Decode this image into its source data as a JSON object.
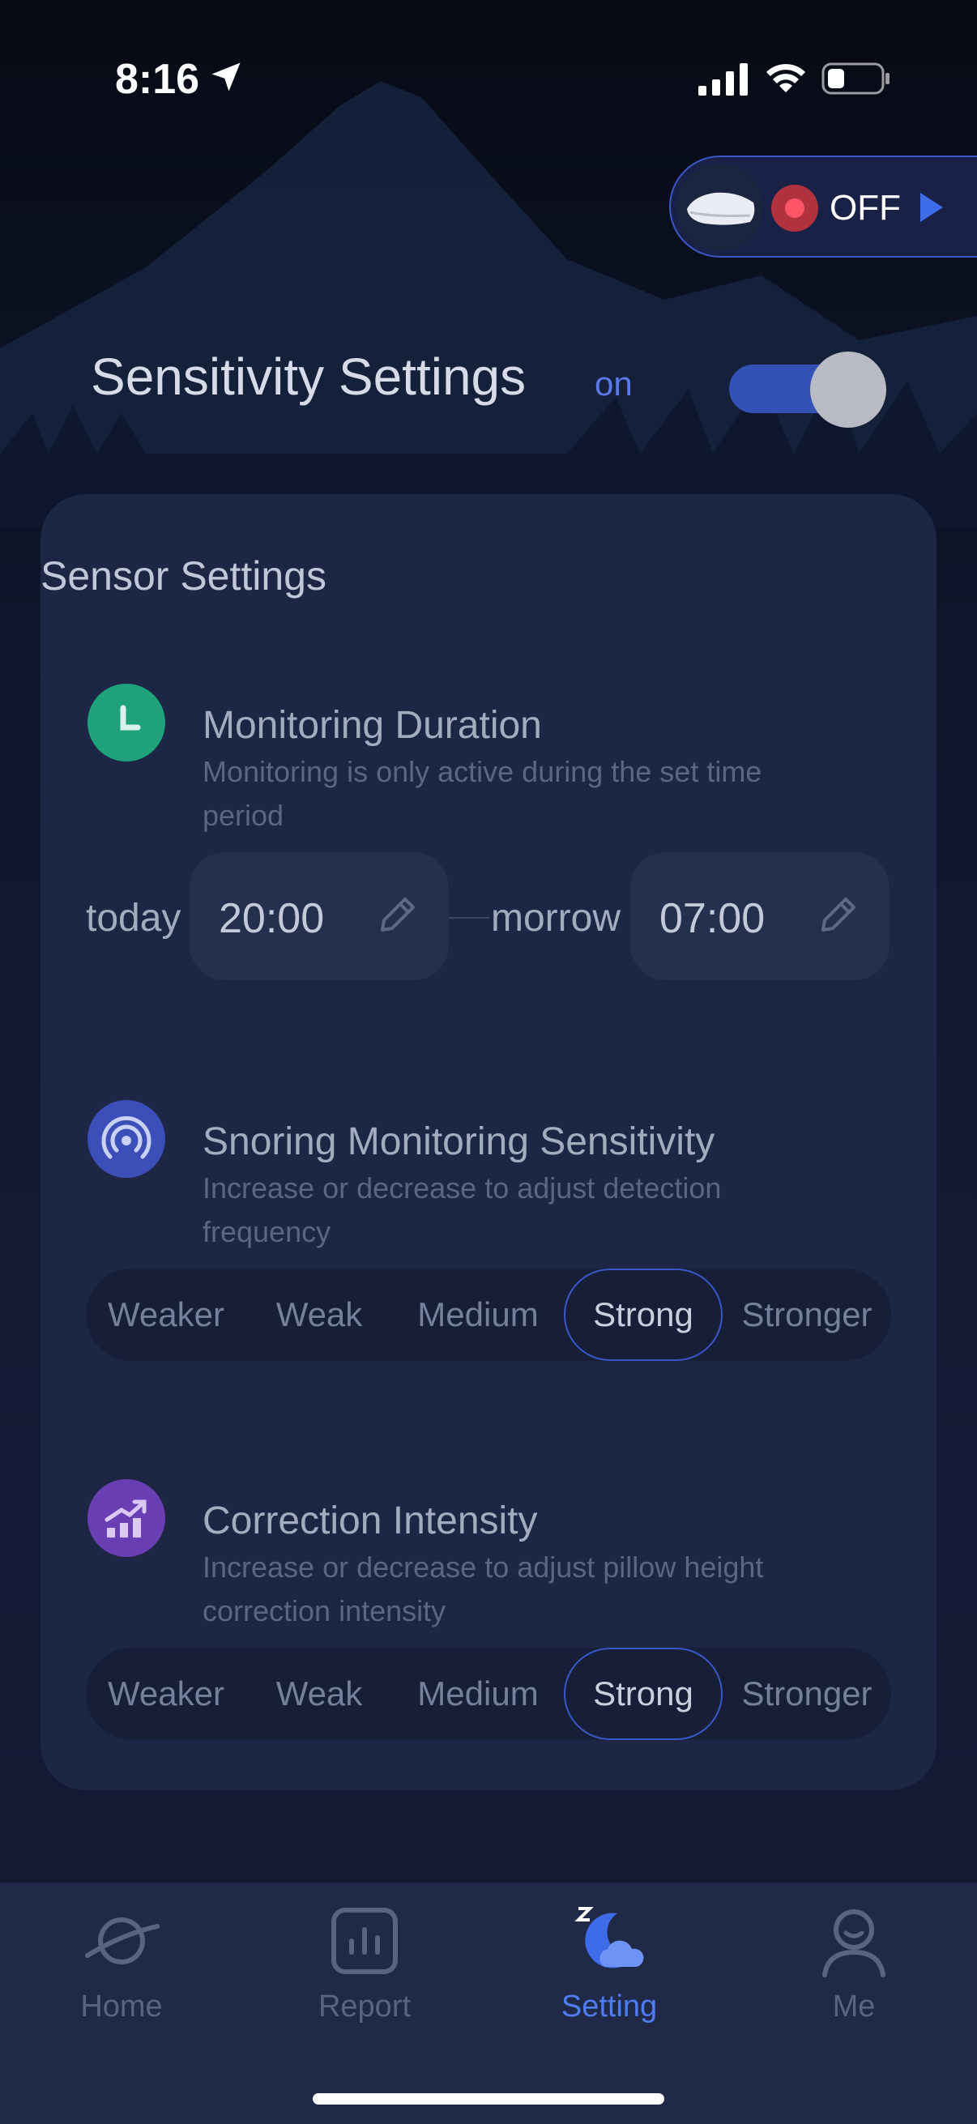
{
  "status_bar": {
    "time": "8:16"
  },
  "device": {
    "status": "OFF"
  },
  "header": {
    "title": "Sensitivity Settings",
    "state": "on"
  },
  "card": {
    "title": "Sensor Settings",
    "monitoring": {
      "title": "Monitoring Duration",
      "description": "Monitoring is only active during the set time period",
      "start_label": "today",
      "start_time": "20:00",
      "end_label": "morrow",
      "end_time": "07:00"
    },
    "snoring": {
      "title": "Snoring Monitoring Sensitivity",
      "description": "Increase or decrease to adjust detection frequency",
      "options": [
        "Weaker",
        "Weak",
        "Medium",
        "Strong",
        "Stronger"
      ],
      "selected": "Strong"
    },
    "correction": {
      "title": "Correction Intensity",
      "description": "Increase or decrease to adjust pillow height correction intensity",
      "options": [
        "Weaker",
        "Weak",
        "Medium",
        "Strong",
        "Stronger"
      ],
      "selected": "Strong"
    }
  },
  "tabbar": {
    "tabs": [
      {
        "label": "Home",
        "icon": "planet-icon"
      },
      {
        "label": "Report",
        "icon": "bar-chart-icon"
      },
      {
        "label": "Setting",
        "icon": "moon-cloud-icon",
        "active": true
      },
      {
        "label": "Me",
        "icon": "user-icon"
      }
    ]
  },
  "colors": {
    "accent": "#4f7cf0",
    "card": "#1d2645",
    "toggle_on": "#3451b5"
  }
}
